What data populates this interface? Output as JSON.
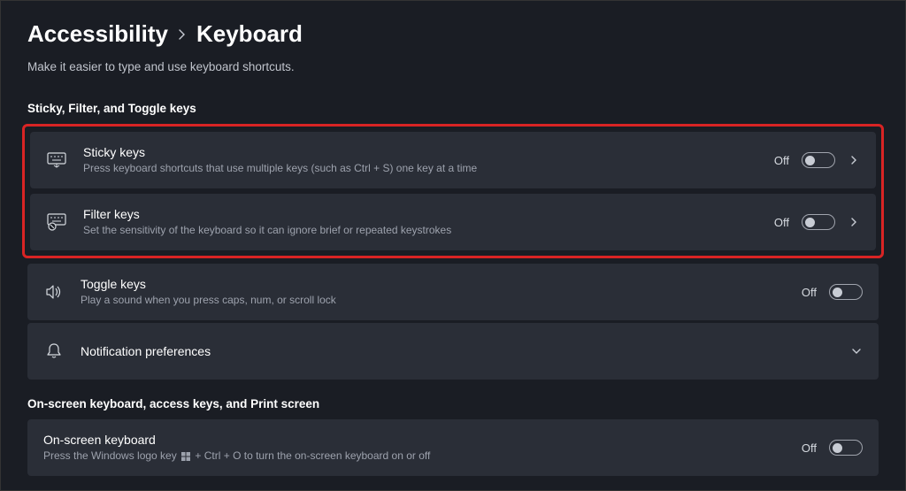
{
  "breadcrumb": {
    "parent": "Accessibility",
    "current": "Keyboard"
  },
  "subtitle": "Make it easier to type and use keyboard shortcuts.",
  "section1": {
    "header": "Sticky, Filter, and Toggle keys",
    "sticky": {
      "title": "Sticky keys",
      "desc": "Press keyboard shortcuts that use multiple keys (such as Ctrl + S) one key at a time",
      "state": "Off"
    },
    "filter": {
      "title": "Filter keys",
      "desc": "Set the sensitivity of the keyboard so it can ignore brief or repeated keystrokes",
      "state": "Off"
    },
    "toggle": {
      "title": "Toggle keys",
      "desc": "Play a sound when you press caps, num, or scroll lock",
      "state": "Off"
    },
    "notification": {
      "title": "Notification preferences"
    }
  },
  "section2": {
    "header": "On-screen keyboard, access keys, and Print screen",
    "osk": {
      "title": "On-screen keyboard",
      "desc_pre": "Press the Windows logo key ",
      "desc_post": " + Ctrl + O to turn the on-screen keyboard on or off",
      "state": "Off"
    }
  }
}
